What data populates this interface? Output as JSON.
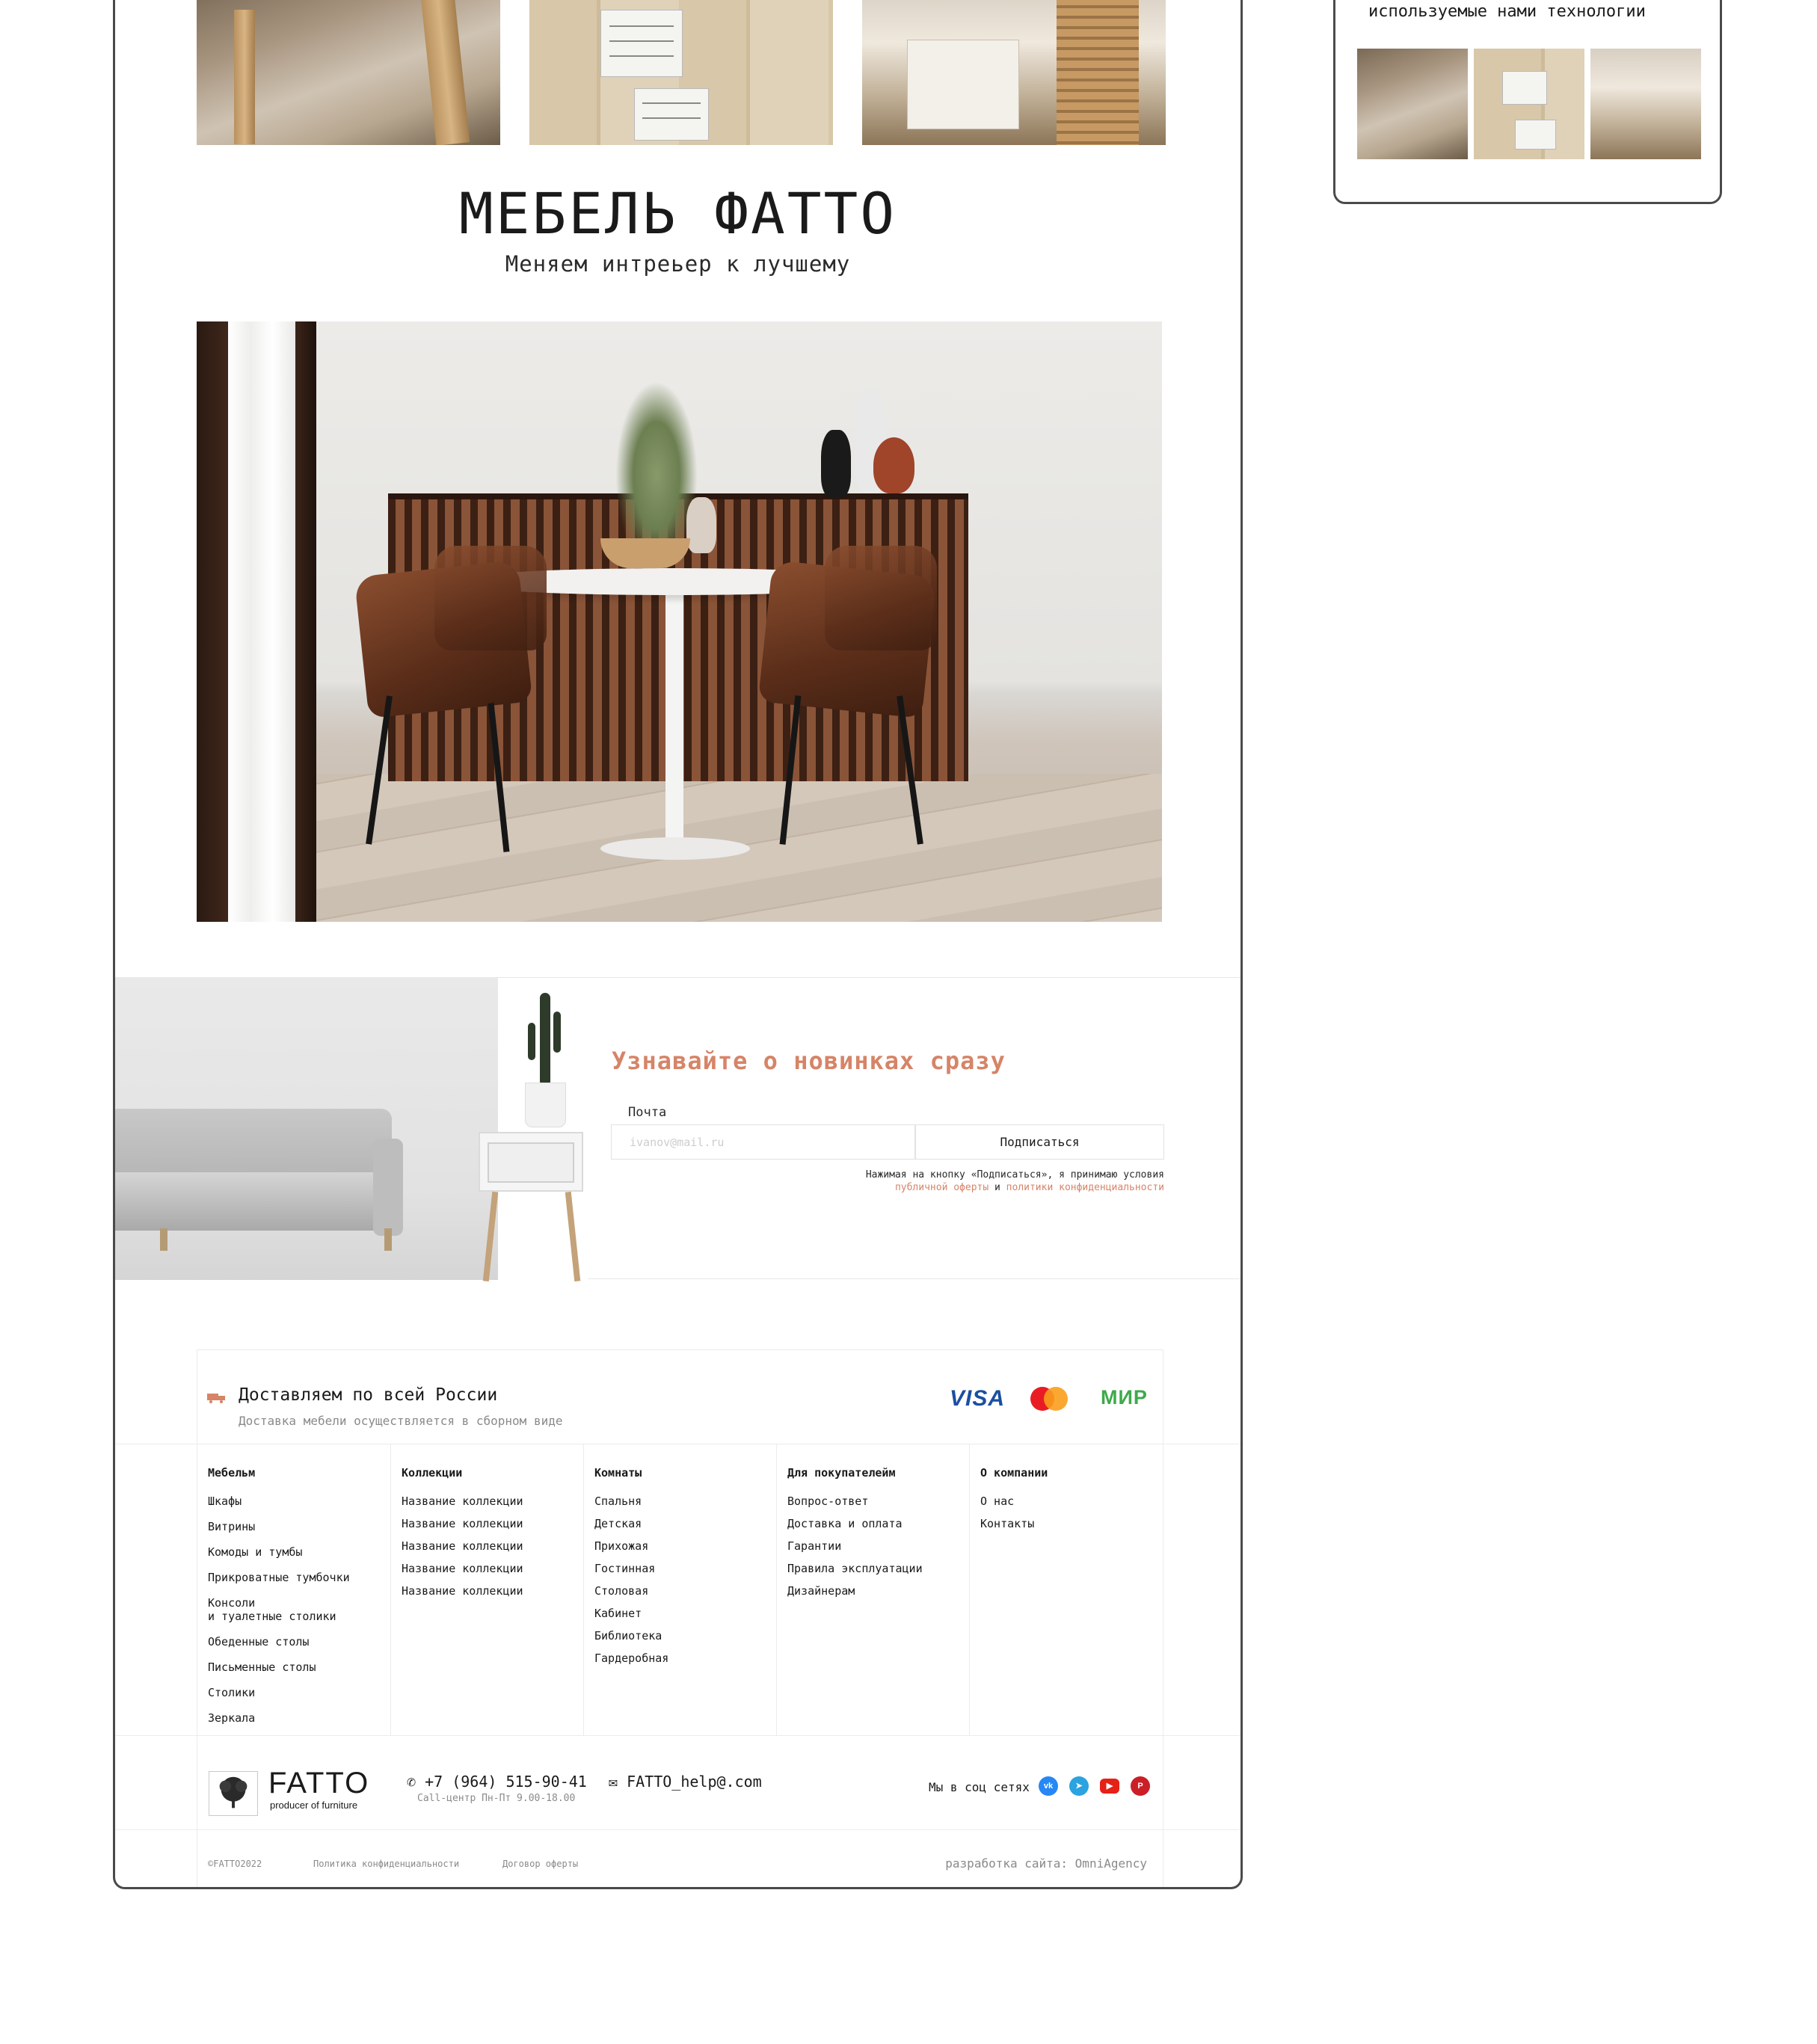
{
  "main": {
    "title": "МЕБЕЛЬ ФАТТО",
    "subtitle": "Меняем интреьер к лучшему"
  },
  "newsletter": {
    "title": "Узнавайте о новинках сразу",
    "email_label": "Почта",
    "email_placeholder": "ivanov@mail.ru",
    "email_value": "",
    "button_label": "Подписаться",
    "note_text": "Нажимая на кнопку «Подписаться», я принимаю условия",
    "note_link_offer": "публичной оферты",
    "note_and": "и",
    "note_link_privacy": "политики конфиденциальности"
  },
  "footer": {
    "delivery_title": "Доставляем по всей России",
    "delivery_subtitle": "Доставка мебели осуществляется в сборном виде",
    "payments": {
      "visa": "VISA",
      "mir": "МИР"
    },
    "columns": {
      "furniture": {
        "heading": "Мебельм",
        "items": [
          "Шкафы",
          "Витрины",
          "Комоды и тумбы",
          "Прикроватные тумбочки",
          "Консоли",
          "и туалетные столики",
          "Обеденные столы",
          "Письменные столы",
          "Столики",
          "Зеркала"
        ]
      },
      "collections": {
        "heading": "Коллекции",
        "items": [
          "Название коллекции",
          "Название коллекции",
          "Название коллекции",
          "Название коллекции",
          "Название коллекции"
        ]
      },
      "rooms": {
        "heading": "Комнаты",
        "items": [
          "Спальня",
          "Детская",
          "Прихожая",
          "Гостинная",
          "Столовая",
          "Кабинет",
          "Библиотека",
          "Гардеробная"
        ]
      },
      "buyers": {
        "heading": "Для покупателейм",
        "items": [
          "Вопрос-ответ",
          "Доставка и оплата",
          "Гарантии",
          "Правила эксплуатации",
          "Дизайнерам"
        ]
      },
      "company": {
        "heading": "О компании",
        "items": [
          "О нас",
          "Контакты"
        ]
      }
    },
    "logo_text": "FATTO",
    "logo_tagline": "producer of furniture",
    "phone": "+7 (964) 515-90-41",
    "phone_hours": "Call-центр Пн-Пт 9.00-18.00",
    "email": "FATTO_help@.com",
    "social_label": "Мы в соц сетях",
    "copyright": "©FATTO2022",
    "privacy_link": "Политика конфиденциальности",
    "offer_link": "Договор оферты",
    "developer": "разработка сайта: OmniAgency"
  },
  "side_card": {
    "text": "используемые нами технологии"
  },
  "colors": {
    "accent": "#d68468",
    "border": "#4a4a4a",
    "muted": "#8a8a8a",
    "vk": "#2787f5",
    "telegram": "#2aa3e0",
    "youtube": "#e62117",
    "pinterest": "#cb1f27"
  },
  "icons": [
    "truck-icon",
    "phone-icon",
    "mail-icon",
    "vk-icon",
    "telegram-icon",
    "youtube-icon",
    "pinterest-icon",
    "tree-logo-icon"
  ]
}
